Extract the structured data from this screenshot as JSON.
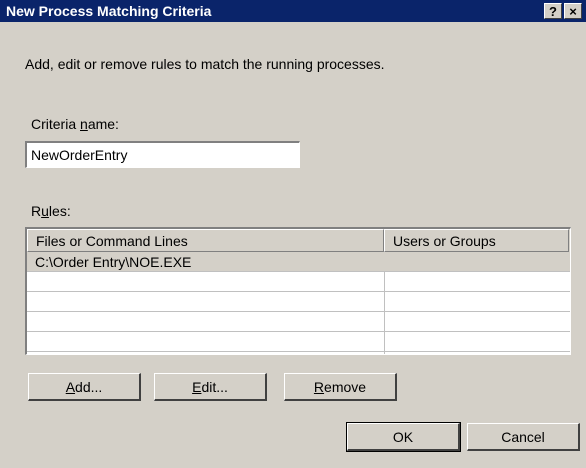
{
  "window": {
    "title": "New Process Matching Criteria",
    "help_label": "?",
    "close_label": "×"
  },
  "instructions": "Add, edit or remove rules to match the running processes.",
  "criteria": {
    "label_before": "Criteria ",
    "label_accel": "n",
    "label_after": "ame:",
    "value": "NewOrderEntry"
  },
  "rules": {
    "label_before": "R",
    "label_accel": "u",
    "label_after": "les:",
    "columns": [
      "Files or Command Lines",
      "Users or Groups"
    ],
    "rows": [
      {
        "file": "C:\\Order Entry\\NOE.EXE",
        "user": ""
      }
    ]
  },
  "buttons": {
    "add_accel": "A",
    "add_rest": "dd...",
    "edit_accel": "E",
    "edit_rest": "dit...",
    "remove_accel": "R",
    "remove_rest": "emove",
    "ok": "OK",
    "cancel": "Cancel"
  }
}
